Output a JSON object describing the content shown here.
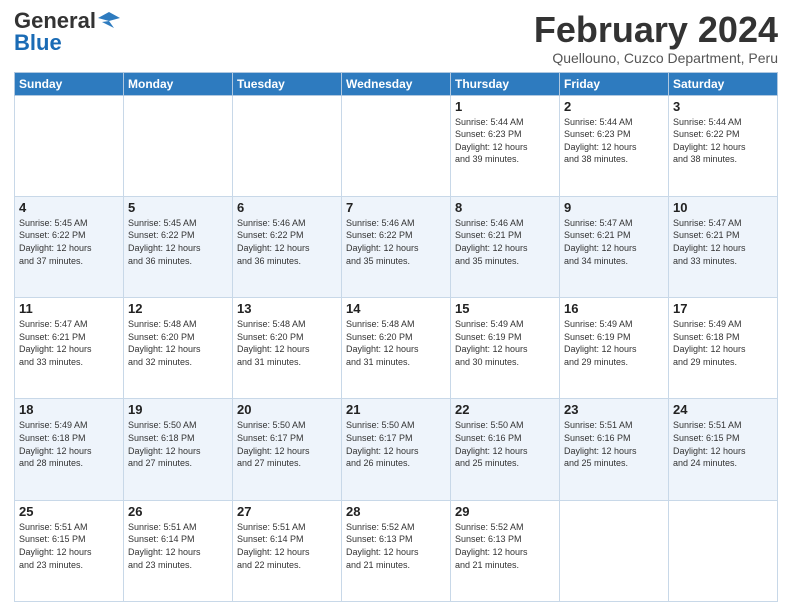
{
  "header": {
    "logo_general": "General",
    "logo_blue": "Blue",
    "title": "February 2024",
    "location": "Quellouno, Cuzco Department, Peru"
  },
  "weekdays": [
    "Sunday",
    "Monday",
    "Tuesday",
    "Wednesday",
    "Thursday",
    "Friday",
    "Saturday"
  ],
  "weeks": [
    [
      {
        "day": "",
        "info": ""
      },
      {
        "day": "",
        "info": ""
      },
      {
        "day": "",
        "info": ""
      },
      {
        "day": "",
        "info": ""
      },
      {
        "day": "1",
        "info": "Sunrise: 5:44 AM\nSunset: 6:23 PM\nDaylight: 12 hours\nand 39 minutes."
      },
      {
        "day": "2",
        "info": "Sunrise: 5:44 AM\nSunset: 6:23 PM\nDaylight: 12 hours\nand 38 minutes."
      },
      {
        "day": "3",
        "info": "Sunrise: 5:44 AM\nSunset: 6:22 PM\nDaylight: 12 hours\nand 38 minutes."
      }
    ],
    [
      {
        "day": "4",
        "info": "Sunrise: 5:45 AM\nSunset: 6:22 PM\nDaylight: 12 hours\nand 37 minutes."
      },
      {
        "day": "5",
        "info": "Sunrise: 5:45 AM\nSunset: 6:22 PM\nDaylight: 12 hours\nand 36 minutes."
      },
      {
        "day": "6",
        "info": "Sunrise: 5:46 AM\nSunset: 6:22 PM\nDaylight: 12 hours\nand 36 minutes."
      },
      {
        "day": "7",
        "info": "Sunrise: 5:46 AM\nSunset: 6:22 PM\nDaylight: 12 hours\nand 35 minutes."
      },
      {
        "day": "8",
        "info": "Sunrise: 5:46 AM\nSunset: 6:21 PM\nDaylight: 12 hours\nand 35 minutes."
      },
      {
        "day": "9",
        "info": "Sunrise: 5:47 AM\nSunset: 6:21 PM\nDaylight: 12 hours\nand 34 minutes."
      },
      {
        "day": "10",
        "info": "Sunrise: 5:47 AM\nSunset: 6:21 PM\nDaylight: 12 hours\nand 33 minutes."
      }
    ],
    [
      {
        "day": "11",
        "info": "Sunrise: 5:47 AM\nSunset: 6:21 PM\nDaylight: 12 hours\nand 33 minutes."
      },
      {
        "day": "12",
        "info": "Sunrise: 5:48 AM\nSunset: 6:20 PM\nDaylight: 12 hours\nand 32 minutes."
      },
      {
        "day": "13",
        "info": "Sunrise: 5:48 AM\nSunset: 6:20 PM\nDaylight: 12 hours\nand 31 minutes."
      },
      {
        "day": "14",
        "info": "Sunrise: 5:48 AM\nSunset: 6:20 PM\nDaylight: 12 hours\nand 31 minutes."
      },
      {
        "day": "15",
        "info": "Sunrise: 5:49 AM\nSunset: 6:19 PM\nDaylight: 12 hours\nand 30 minutes."
      },
      {
        "day": "16",
        "info": "Sunrise: 5:49 AM\nSunset: 6:19 PM\nDaylight: 12 hours\nand 29 minutes."
      },
      {
        "day": "17",
        "info": "Sunrise: 5:49 AM\nSunset: 6:18 PM\nDaylight: 12 hours\nand 29 minutes."
      }
    ],
    [
      {
        "day": "18",
        "info": "Sunrise: 5:49 AM\nSunset: 6:18 PM\nDaylight: 12 hours\nand 28 minutes."
      },
      {
        "day": "19",
        "info": "Sunrise: 5:50 AM\nSunset: 6:18 PM\nDaylight: 12 hours\nand 27 minutes."
      },
      {
        "day": "20",
        "info": "Sunrise: 5:50 AM\nSunset: 6:17 PM\nDaylight: 12 hours\nand 27 minutes."
      },
      {
        "day": "21",
        "info": "Sunrise: 5:50 AM\nSunset: 6:17 PM\nDaylight: 12 hours\nand 26 minutes."
      },
      {
        "day": "22",
        "info": "Sunrise: 5:50 AM\nSunset: 6:16 PM\nDaylight: 12 hours\nand 25 minutes."
      },
      {
        "day": "23",
        "info": "Sunrise: 5:51 AM\nSunset: 6:16 PM\nDaylight: 12 hours\nand 25 minutes."
      },
      {
        "day": "24",
        "info": "Sunrise: 5:51 AM\nSunset: 6:15 PM\nDaylight: 12 hours\nand 24 minutes."
      }
    ],
    [
      {
        "day": "25",
        "info": "Sunrise: 5:51 AM\nSunset: 6:15 PM\nDaylight: 12 hours\nand 23 minutes."
      },
      {
        "day": "26",
        "info": "Sunrise: 5:51 AM\nSunset: 6:14 PM\nDaylight: 12 hours\nand 23 minutes."
      },
      {
        "day": "27",
        "info": "Sunrise: 5:51 AM\nSunset: 6:14 PM\nDaylight: 12 hours\nand 22 minutes."
      },
      {
        "day": "28",
        "info": "Sunrise: 5:52 AM\nSunset: 6:13 PM\nDaylight: 12 hours\nand 21 minutes."
      },
      {
        "day": "29",
        "info": "Sunrise: 5:52 AM\nSunset: 6:13 PM\nDaylight: 12 hours\nand 21 minutes."
      },
      {
        "day": "",
        "info": ""
      },
      {
        "day": "",
        "info": ""
      }
    ]
  ]
}
